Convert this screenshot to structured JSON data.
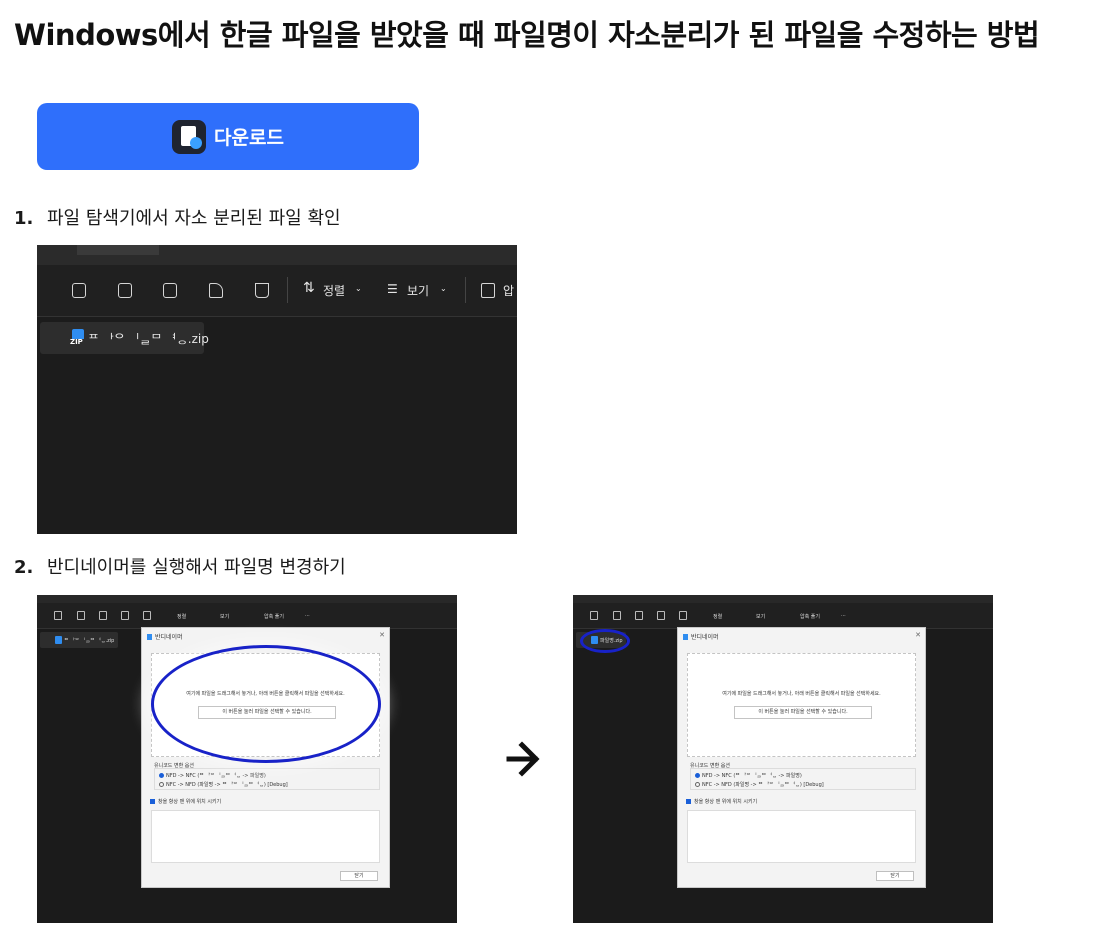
{
  "page": {
    "title": "Windows에서 한글 파일을 받았을 때 파일명이 자소분리가 된 파일을 수정하는 방법"
  },
  "download": {
    "label": "다운로드",
    "icon": "bandi-app-icon"
  },
  "steps": [
    {
      "num": "1.",
      "text": "파일 탐색기에서 자소 분리된 파일 확인"
    },
    {
      "num": "2.",
      "text": "반디네이머를 실행해서 파일명 변경하기"
    }
  ],
  "explorer": {
    "toolbar": {
      "sort_label": "정렬",
      "view_label": "보기",
      "compress_label": "압"
    },
    "file_before": "ᄑ ᅡᄋ ᅵᆯᄆ ᅧᆼ.zip"
  },
  "dialogs": {
    "before": {
      "mini_sort": "정렬",
      "mini_view": "보기",
      "mini_compress": "압축 풀기",
      "mini_more": "···",
      "file_name": "ᄑ ᅡᄋ ᅵᆯᄆ ᅧᆼ.zip",
      "dialog_title": "반디네이머",
      "drop_text": "여기에 파일을 드래그해서 놓거나, 아래 버튼을 클릭해서 파일을 선택하세요.",
      "pick_button": "이 버튼을 눌러 파일을 선택할 수 있습니다.",
      "option_title": "유니코드 변환 옵션",
      "option_1": "NFD -> NFC (ᄑ ᅡᄋ ᅵᆯᄆ ᅧᆼ -> 파일명)",
      "option_2": "NFC -> NFD (파일명 -> ᄑ ᅡᄋ ᅵᆯᄆ ᅧᆼ) [Debug]",
      "always_on_top": "창을 항상 맨 위에 위치 시키기",
      "close_button": "닫기"
    },
    "after": {
      "file_name": "파일명.zip"
    }
  },
  "colors": {
    "accent": "#2f6ffb",
    "highlight": "#1822c8",
    "explorer_bg": "#1c1c1c"
  }
}
